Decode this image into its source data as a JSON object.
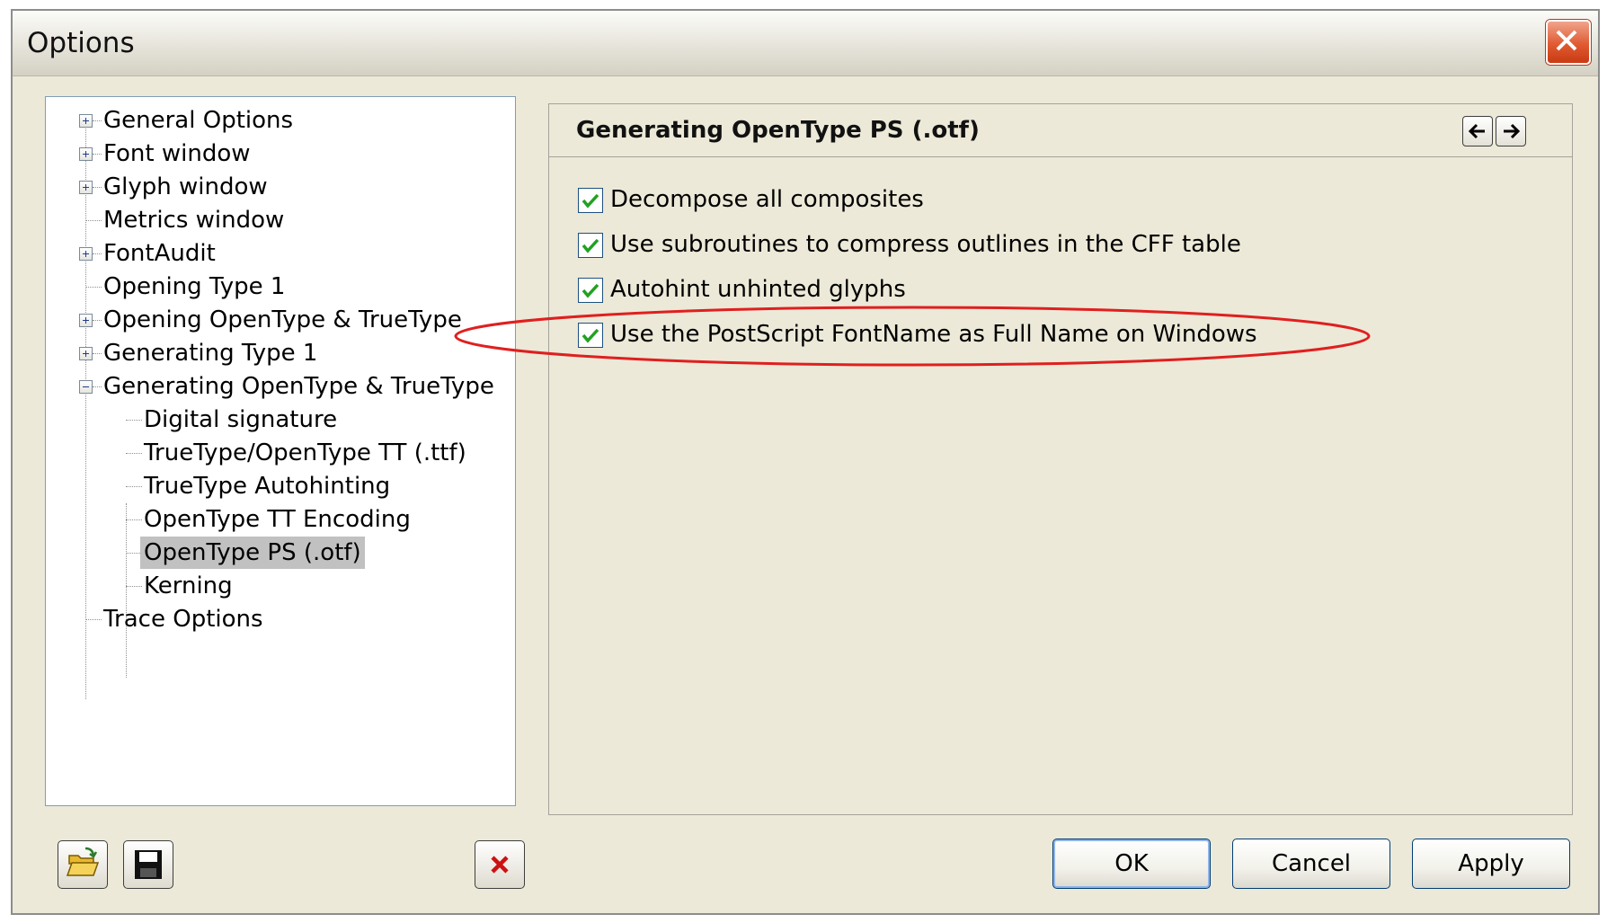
{
  "window": {
    "title": "Options"
  },
  "tree": {
    "items": [
      {
        "label": "General Options",
        "expander": "plus"
      },
      {
        "label": "Font window",
        "expander": "plus"
      },
      {
        "label": "Glyph window",
        "expander": "plus"
      },
      {
        "label": "Metrics window",
        "expander": "none"
      },
      {
        "label": "FontAudit",
        "expander": "plus"
      },
      {
        "label": "Opening Type 1",
        "expander": "none"
      },
      {
        "label": "Opening OpenType & TrueType",
        "expander": "plus"
      },
      {
        "label": "Generating Type 1",
        "expander": "plus"
      },
      {
        "label": "Generating OpenType & TrueType",
        "expander": "minus"
      },
      {
        "label": "Digital signature",
        "expander": "none"
      },
      {
        "label": "TrueType/OpenType TT (.ttf)",
        "expander": "none"
      },
      {
        "label": "TrueType Autohinting",
        "expander": "none"
      },
      {
        "label": "OpenType TT Encoding",
        "expander": "none"
      },
      {
        "label": "OpenType PS (.otf)",
        "expander": "none",
        "selected": true
      },
      {
        "label": "Kerning",
        "expander": "none"
      },
      {
        "label": "Trace Options",
        "expander": "none"
      }
    ]
  },
  "content": {
    "title": "Generating OpenType PS (.otf)",
    "options": [
      {
        "label": "Decompose all composites",
        "checked": true
      },
      {
        "label": "Use subroutines to compress outlines in the CFF table",
        "checked": true
      },
      {
        "label": "Autohint unhinted glyphs",
        "checked": true
      },
      {
        "label": "Use the PostScript FontName as Full Name on Windows",
        "checked": true
      }
    ]
  },
  "buttons": {
    "ok": "OK",
    "cancel": "Cancel",
    "apply": "Apply"
  },
  "icons": {
    "open": "folder-open-icon",
    "save": "save-disk-icon",
    "delete": "delete-x-icon",
    "back": "arrow-left-icon",
    "forward": "arrow-right-icon",
    "close": "close-icon"
  },
  "colors": {
    "highlight": "#e01f1f",
    "selection": "#c1c1c1",
    "check": "#21a121",
    "delete": "#cc1111"
  }
}
